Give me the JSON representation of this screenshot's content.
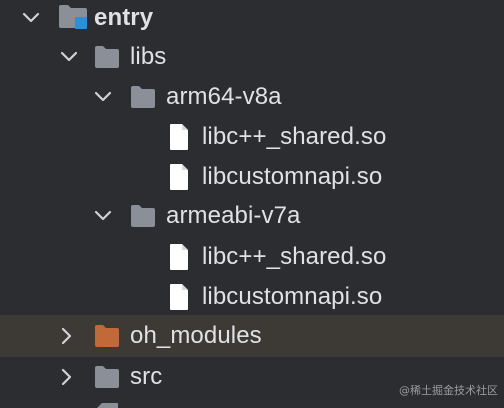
{
  "tree": {
    "root": {
      "label": "entry",
      "expanded": true,
      "folder_color": "#8a8f98",
      "module_badge_color": "#2a90d9"
    },
    "libs": {
      "label": "libs",
      "expanded": true,
      "folder_color": "#8a8f98"
    },
    "arm64": {
      "label": "arm64-v8a",
      "expanded": true,
      "folder_color": "#8a8f98"
    },
    "arm64_files": [
      {
        "label": "libc++_shared.so"
      },
      {
        "label": "libcustomnapi.so"
      }
    ],
    "armeabi": {
      "label": "armeabi-v7a",
      "expanded": true,
      "folder_color": "#8a8f98"
    },
    "armeabi_files": [
      {
        "label": "libc++_shared.so"
      },
      {
        "label": "libcustomnapi.so"
      }
    ],
    "oh_modules": {
      "label": "oh_modules",
      "expanded": false,
      "folder_color": "#c2693a",
      "selected": true
    },
    "src": {
      "label": "src",
      "expanded": false,
      "folder_color": "#8a8f98"
    }
  },
  "colors": {
    "background": "#2b2d30",
    "selection": "#3d3a36",
    "text": "#dfe1e5",
    "chevron": "#cfd1d5",
    "file_icon": "#ffffff"
  },
  "watermark": "@稀土掘金技术社区"
}
